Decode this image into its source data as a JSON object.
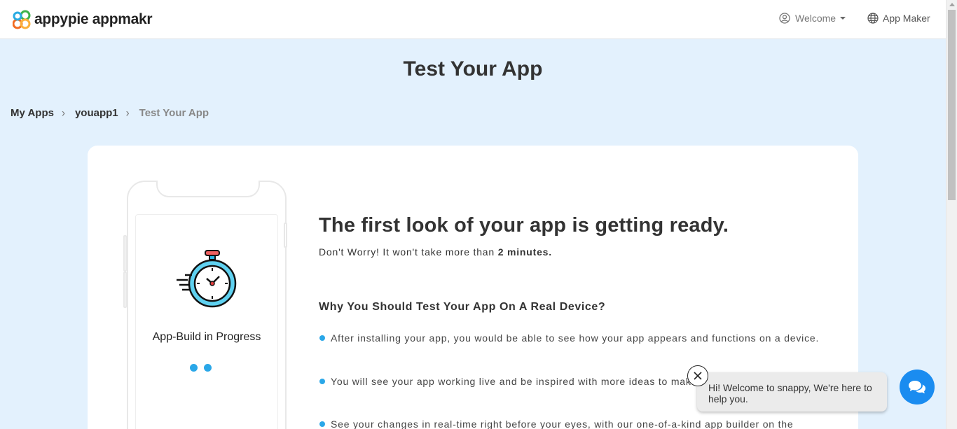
{
  "header": {
    "logo_text": "appypie appmakr",
    "welcome_label": "Welcome",
    "appmaker_label": "App Maker",
    "icons": {
      "user": "user-circle-icon",
      "globe": "globe-icon",
      "caret": "caret-down-icon"
    }
  },
  "page": {
    "title": "Test Your App"
  },
  "breadcrumb": {
    "items": [
      {
        "label": "My Apps"
      },
      {
        "label": "youapp1"
      },
      {
        "label": "Test Your App"
      }
    ]
  },
  "phone": {
    "status": "App-Build in Progress"
  },
  "main": {
    "headline": "The first look of your app is getting ready.",
    "subline_prefix": "Don't Worry! It won't take more than",
    "subline_bold": "2 minutes.",
    "why_title": "Why You Should Test Your App On A Real Device?",
    "bullets": [
      "After installing your app, you would be able to see how your app appears and functions on a device.",
      "You will see your app working live and be inspired with more ideas to make it even better for your users.",
      "See your changes in real-time right before your eyes, with our one-of-a-kind app builder on the"
    ]
  },
  "chat": {
    "message": "Hi! Welcome to snappy, We're here to help you."
  },
  "colors": {
    "accent": "#2aa7e8",
    "chat_button": "#1a8cf0",
    "background": "#e3f1fd"
  }
}
